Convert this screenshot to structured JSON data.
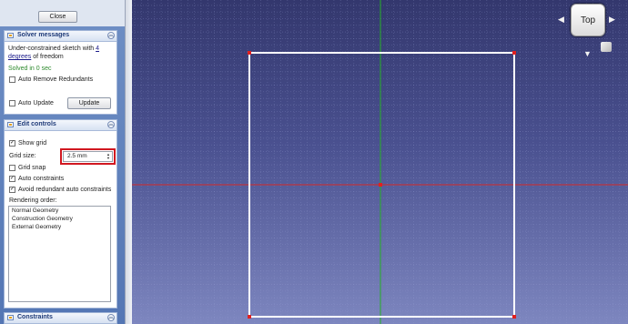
{
  "panel": {
    "close_label": "Close",
    "solver": {
      "title": "Solver messages",
      "message_prefix": "Under-constrained sketch with",
      "dof_count": "4",
      "dof_link": "degrees",
      "message_suffix": "of freedom",
      "solved_text": "Solved in 0 sec",
      "auto_remove_redundants": {
        "label": "Auto Remove Redundants",
        "checked": false
      },
      "auto_update": {
        "label": "Auto Update",
        "checked": false
      },
      "update_label": "Update"
    },
    "edit_controls": {
      "title": "Edit controls",
      "show_grid": {
        "label": "Show grid",
        "checked": true
      },
      "grid_size_label": "Grid size:",
      "grid_size_value": "2.5 mm",
      "grid_snap": {
        "label": "Grid snap",
        "checked": false
      },
      "auto_constraints": {
        "label": "Auto constraints",
        "checked": true
      },
      "avoid_redundant": {
        "label": "Avoid redundant auto constraints",
        "checked": true
      },
      "rendering_order_label": "Rendering order:",
      "rendering_order": [
        "Normal Geometry",
        "Construction Geometry",
        "External Geometry"
      ]
    },
    "constraints": {
      "title": "Constraints"
    }
  },
  "viewport": {
    "navcube_face": "Top",
    "colors": {
      "x_axis": "#d42a2a",
      "y_axis": "#25b025",
      "sketch_edge": "#ffffff",
      "vertex": "#e02020"
    },
    "navcube_icons": [
      "arrow-left-icon",
      "arrow-right-icon",
      "arrow-down-icon",
      "mini-cube-icon"
    ]
  }
}
